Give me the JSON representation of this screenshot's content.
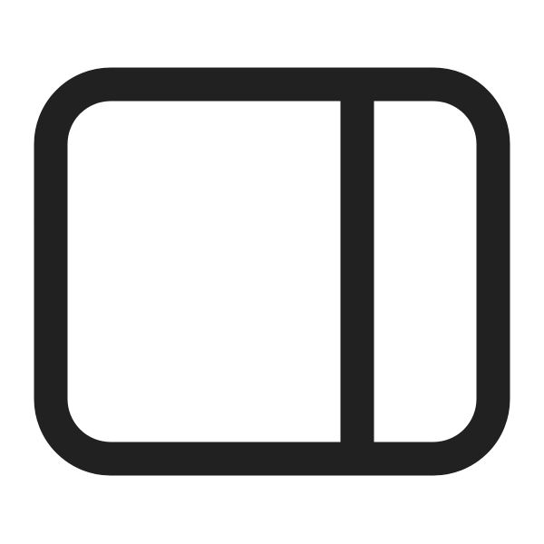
{
  "icon": {
    "name": "sidebar-right-icon",
    "stroke_color": "#212121",
    "background_color": "#ffffff"
  }
}
